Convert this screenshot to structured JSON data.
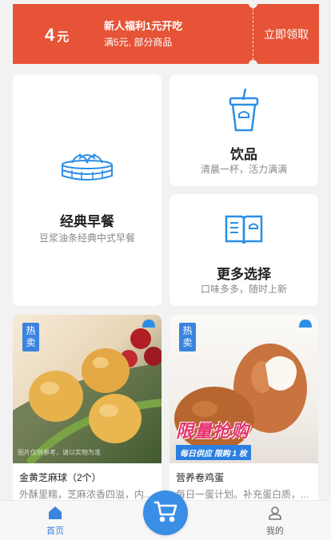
{
  "coupon": {
    "amount": "4",
    "unit": "元",
    "title": "新人福利1元开吃",
    "subtitle": "满5元, 部分商品",
    "claim_label": "立即领取"
  },
  "categories": [
    {
      "name": "经典早餐",
      "desc": "豆浆油条经典中式早餐",
      "icon": "steamed-buns-icon"
    },
    {
      "name": "饮品",
      "desc": "清晨一杯，活力满满",
      "icon": "drink-cup-icon"
    },
    {
      "name": "更多选择",
      "desc": "口味多多，随时上新",
      "icon": "open-book-icon"
    }
  ],
  "products": [
    {
      "badge": "热卖",
      "name": "金黄芝麻球（2个）",
      "desc": "外酥里糯，芝麻浓香四溢，内...",
      "watermark": "图片仅供参考，请以实物为准"
    },
    {
      "badge": "热卖",
      "name": "营养卷鸡蛋",
      "desc": "每日一蛋计划。补充蛋白质，...",
      "promo_title": "限量抢购",
      "promo_sub": "每日供应  限购 1 枚"
    }
  ],
  "tabbar": {
    "home_label": "首页",
    "mine_label": "我的",
    "home_icon": "home-icon",
    "cart_icon": "cart-icon",
    "mine_icon": "user-icon"
  },
  "colors": {
    "coupon_bg": "#e65336",
    "accent_blue": "#3a84e0",
    "promo_pink": "#e6306e"
  }
}
